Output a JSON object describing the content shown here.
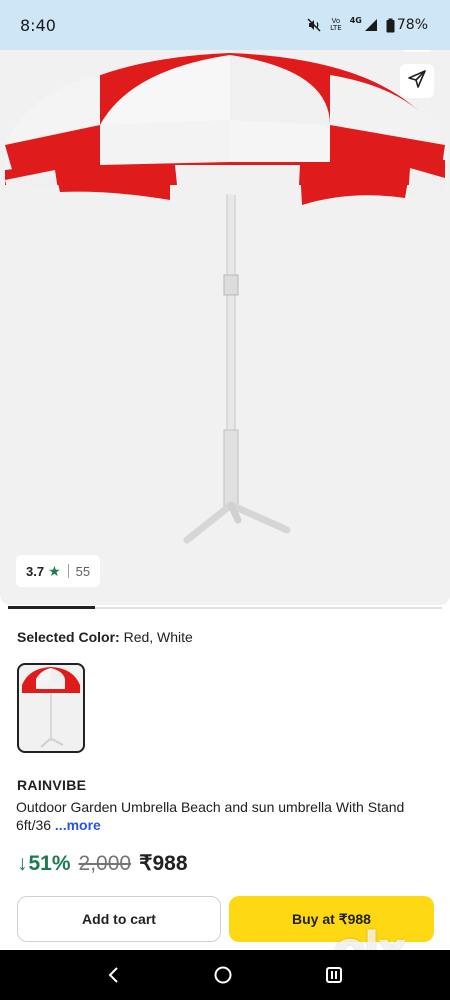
{
  "status_bar": {
    "time": "8:40",
    "battery": "78%",
    "network": "4G",
    "volte_line1": "Vo",
    "volte_line2": "LTE"
  },
  "product": {
    "rating": "3.7",
    "rating_count": "55",
    "selected_color_label": "Selected Color:",
    "selected_color_value": "Red, White",
    "brand": "RAINVIBE",
    "title": "Outdoor Garden Umbrella Beach and sun umbrella With Stand 6ft/36",
    "more_link": "...more",
    "discount": "51%",
    "mrp": "2,000",
    "price": "₹988"
  },
  "actions": {
    "add_to_cart": "Add to cart",
    "buy_now": "Buy at ₹988"
  },
  "watermark": "olx",
  "colors": {
    "accent_yellow": "#ffd814",
    "discount_green": "#1b7a4f",
    "link_blue": "#2a55e5",
    "umbrella_red": "#e01b1b"
  },
  "icons": [
    "mute-icon",
    "signal-icon",
    "battery-icon",
    "share-icon",
    "star-icon",
    "down-arrow-icon",
    "back-nav-icon",
    "home-nav-icon",
    "recents-nav-icon"
  ]
}
